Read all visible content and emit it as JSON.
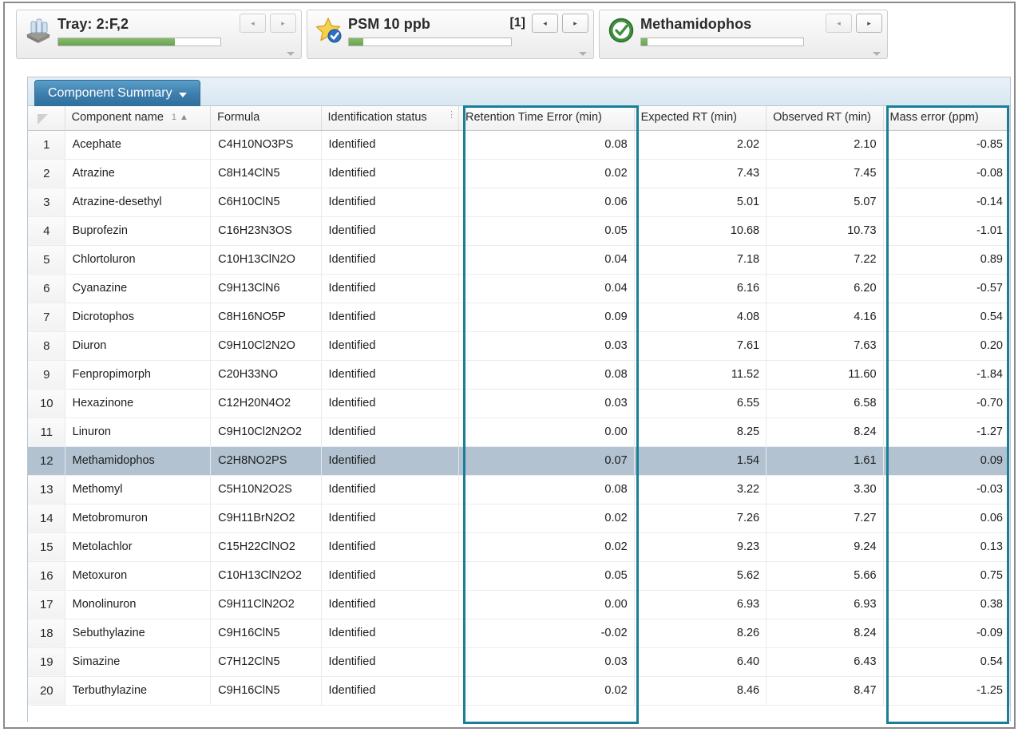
{
  "navigator": {
    "panels": [
      {
        "icon": "tray-icon",
        "title": "Tray: 2:F,2",
        "index": "",
        "progress_percent": 72,
        "prev_label": "◂",
        "next_label": "▸",
        "prev_enabled": false,
        "next_enabled": false
      },
      {
        "icon": "star-check-icon",
        "title": "PSM 10 ppb",
        "index": "[1]",
        "progress_percent": 9,
        "prev_label": "◂",
        "next_label": "▸",
        "prev_enabled": true,
        "next_enabled": true
      },
      {
        "icon": "green-check-icon",
        "title": "Methamidophos",
        "index": "",
        "progress_percent": 4,
        "prev_label": "◂",
        "next_label": "▸",
        "prev_enabled": false,
        "next_enabled": true
      }
    ]
  },
  "tab": {
    "label": "Component Summary",
    "caret": "dropdown-caret"
  },
  "table": {
    "columns": [
      {
        "key": "row",
        "label": "",
        "align": "center"
      },
      {
        "key": "name",
        "label": "Component name",
        "align": "left",
        "sort_order": "1",
        "sort_dir": "▲"
      },
      {
        "key": "formula",
        "label": "Formula",
        "align": "left"
      },
      {
        "key": "status",
        "label": "Identification status",
        "align": "left"
      },
      {
        "key": "rte",
        "label": "Retention Time Error (min)",
        "align": "left"
      },
      {
        "key": "ert",
        "label": "Expected RT (min)",
        "align": "left"
      },
      {
        "key": "ort",
        "label": "Observed RT (min)",
        "align": "left"
      },
      {
        "key": "mass",
        "label": "Mass error (ppm)",
        "align": "left"
      }
    ],
    "selected_row": 12,
    "rows": [
      {
        "row": "1",
        "name": "Acephate",
        "formula": "C4H10NO3PS",
        "status": "Identified",
        "rte": "0.08",
        "ert": "2.02",
        "ort": "2.10",
        "mass": "-0.85"
      },
      {
        "row": "2",
        "name": "Atrazine",
        "formula": "C8H14ClN5",
        "status": "Identified",
        "rte": "0.02",
        "ert": "7.43",
        "ort": "7.45",
        "mass": "-0.08"
      },
      {
        "row": "3",
        "name": "Atrazine-desethyl",
        "formula": "C6H10ClN5",
        "status": "Identified",
        "rte": "0.06",
        "ert": "5.01",
        "ort": "5.07",
        "mass": "-0.14"
      },
      {
        "row": "4",
        "name": "Buprofezin",
        "formula": "C16H23N3OS",
        "status": "Identified",
        "rte": "0.05",
        "ert": "10.68",
        "ort": "10.73",
        "mass": "-1.01"
      },
      {
        "row": "5",
        "name": "Chlortoluron",
        "formula": "C10H13ClN2O",
        "status": "Identified",
        "rte": "0.04",
        "ert": "7.18",
        "ort": "7.22",
        "mass": "0.89"
      },
      {
        "row": "6",
        "name": "Cyanazine",
        "formula": "C9H13ClN6",
        "status": "Identified",
        "rte": "0.04",
        "ert": "6.16",
        "ort": "6.20",
        "mass": "-0.57"
      },
      {
        "row": "7",
        "name": "Dicrotophos",
        "formula": "C8H16NO5P",
        "status": "Identified",
        "rte": "0.09",
        "ert": "4.08",
        "ort": "4.16",
        "mass": "0.54"
      },
      {
        "row": "8",
        "name": "Diuron",
        "formula": "C9H10Cl2N2O",
        "status": "Identified",
        "rte": "0.03",
        "ert": "7.61",
        "ort": "7.63",
        "mass": "0.20"
      },
      {
        "row": "9",
        "name": "Fenpropimorph",
        "formula": "C20H33NO",
        "status": "Identified",
        "rte": "0.08",
        "ert": "11.52",
        "ort": "11.60",
        "mass": "-1.84"
      },
      {
        "row": "10",
        "name": "Hexazinone",
        "formula": "C12H20N4O2",
        "status": "Identified",
        "rte": "0.03",
        "ert": "6.55",
        "ort": "6.58",
        "mass": "-0.70"
      },
      {
        "row": "11",
        "name": "Linuron",
        "formula": "C9H10Cl2N2O2",
        "status": "Identified",
        "rte": "0.00",
        "ert": "8.25",
        "ort": "8.24",
        "mass": "-1.27"
      },
      {
        "row": "12",
        "name": "Methamidophos",
        "formula": "C2H8NO2PS",
        "status": "Identified",
        "rte": "0.07",
        "ert": "1.54",
        "ort": "1.61",
        "mass": "0.09"
      },
      {
        "row": "13",
        "name": "Methomyl",
        "formula": "C5H10N2O2S",
        "status": "Identified",
        "rte": "0.08",
        "ert": "3.22",
        "ort": "3.30",
        "mass": "-0.03"
      },
      {
        "row": "14",
        "name": "Metobromuron",
        "formula": "C9H11BrN2O2",
        "status": "Identified",
        "rte": "0.02",
        "ert": "7.26",
        "ort": "7.27",
        "mass": "0.06"
      },
      {
        "row": "15",
        "name": "Metolachlor",
        "formula": "C15H22ClNO2",
        "status": "Identified",
        "rte": "0.02",
        "ert": "9.23",
        "ort": "9.24",
        "mass": "0.13"
      },
      {
        "row": "16",
        "name": "Metoxuron",
        "formula": "C10H13ClN2O2",
        "status": "Identified",
        "rte": "0.05",
        "ert": "5.62",
        "ort": "5.66",
        "mass": "0.75"
      },
      {
        "row": "17",
        "name": "Monolinuron",
        "formula": "C9H11ClN2O2",
        "status": "Identified",
        "rte": "0.00",
        "ert": "6.93",
        "ort": "6.93",
        "mass": "0.38"
      },
      {
        "row": "18",
        "name": "Sebuthylazine",
        "formula": "C9H16ClN5",
        "status": "Identified",
        "rte": "-0.02",
        "ert": "8.26",
        "ort": "8.24",
        "mass": "-0.09"
      },
      {
        "row": "19",
        "name": "Simazine",
        "formula": "C7H12ClN5",
        "status": "Identified",
        "rte": "0.03",
        "ert": "6.40",
        "ort": "6.43",
        "mass": "0.54"
      },
      {
        "row": "20",
        "name": "Terbuthylazine",
        "formula": "C9H16ClN5",
        "status": "Identified",
        "rte": "0.02",
        "ert": "8.46",
        "ort": "8.47",
        "mass": "-1.25"
      }
    ]
  },
  "annotations": {
    "highlight_color": "#1a7f96",
    "boxes": [
      {
        "name": "retention-time-error-highlight",
        "column": "Retention Time Error (min)"
      },
      {
        "name": "mass-error-highlight",
        "column": "Mass error (ppm)"
      }
    ]
  },
  "colors": {
    "tab_accent": "#2e6f9e",
    "selection": "#b2c2d0",
    "progress": "#6aa352"
  }
}
